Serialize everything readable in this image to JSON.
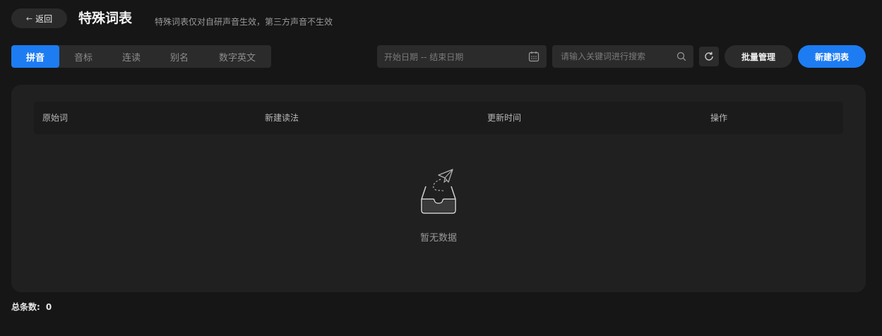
{
  "header": {
    "back_label": "返回",
    "title": "特殊词表",
    "subtitle": "特殊词表仅对自研声音生效，第三方声音不生效"
  },
  "tabs": [
    {
      "label": "拼音",
      "active": true
    },
    {
      "label": "音标",
      "active": false
    },
    {
      "label": "连读",
      "active": false
    },
    {
      "label": "别名",
      "active": false
    },
    {
      "label": "数字英文",
      "active": false
    }
  ],
  "toolbar": {
    "date_placeholder": "开始日期 -- 结束日期",
    "search_placeholder": "请输入关键词进行搜索",
    "batch_label": "批量管理",
    "new_label": "新建词表"
  },
  "table": {
    "columns": [
      "原始词",
      "新建读法",
      "更新时间",
      "操作"
    ],
    "empty_text": "暂无数据"
  },
  "footer": {
    "total_label": "总条数:",
    "total_value": "0"
  },
  "colors": {
    "accent": "#1d7cf2",
    "background": "#161616",
    "panel": "#202020"
  }
}
